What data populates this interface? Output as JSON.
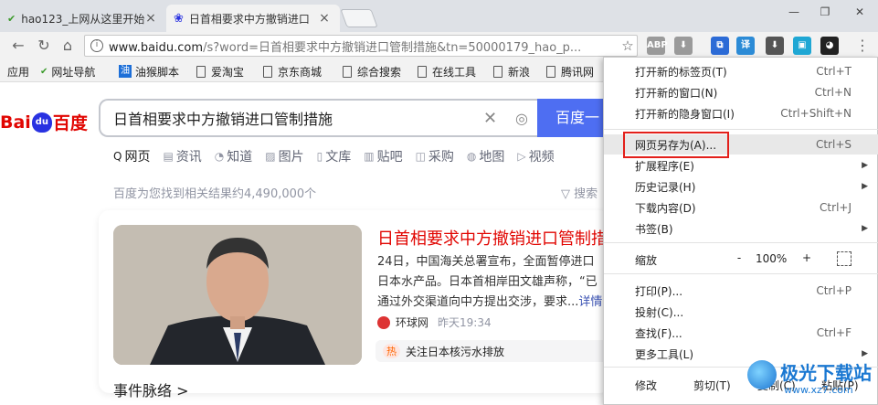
{
  "tabs": [
    {
      "title": "hao123_上网从这里开始",
      "icon": "hao123-icon",
      "active": false
    },
    {
      "title": "日首相要求中方撤销进口",
      "icon": "baidu-paw-icon",
      "active": true
    }
  ],
  "window_controls": {
    "minimize": "—",
    "restore": "❐",
    "close": "✕"
  },
  "toolbar": {
    "url_host": "www.baidu.com",
    "url_rest": "/s?word=日首相要求中方撤销进口管制措施&tn=50000179_hao_p...",
    "extensions": [
      {
        "name": "adblock-plus-icon",
        "label": "ABP",
        "color": "#9a9a9a"
      },
      {
        "name": "download-helper-icon",
        "label": "⬇",
        "color": "#9a9a9a"
      },
      {
        "name": "screenshot-ext-icon",
        "label": "⧉",
        "color": "#2c6bd6"
      },
      {
        "name": "translate-ext-icon",
        "label": "译",
        "color": "#2c8bd6"
      },
      {
        "name": "download-arrow-icon",
        "label": "⬇",
        "color": "#555555"
      },
      {
        "name": "capture-ext-icon",
        "label": "▣",
        "color": "#1fa7d4"
      },
      {
        "name": "mask-ext-icon",
        "label": "◕",
        "color": "#222222"
      }
    ]
  },
  "bookmarks": [
    {
      "label": "应用",
      "icon": "apps"
    },
    {
      "label": "网址导航",
      "icon": "hao"
    },
    {
      "label": "油猴脚本",
      "icon": "oil"
    },
    {
      "label": "爱淘宝",
      "icon": "doc"
    },
    {
      "label": "京东商城",
      "icon": "doc"
    },
    {
      "label": "综合搜索",
      "icon": "doc"
    },
    {
      "label": "在线工具",
      "icon": "doc"
    },
    {
      "label": "新浪",
      "icon": "doc"
    },
    {
      "label": "腾讯网",
      "icon": "doc"
    }
  ],
  "page": {
    "logo": {
      "left": "Bai",
      "paw": "du",
      "right": "百度"
    },
    "query": "日首相要求中方撤销进口管制措施",
    "search_button": "百度一",
    "nav_tabs": [
      {
        "icon": "Q",
        "label": "网页",
        "active": true
      },
      {
        "icon": "▤",
        "label": "资讯"
      },
      {
        "icon": "◔",
        "label": "知道"
      },
      {
        "icon": "▨",
        "label": "图片"
      },
      {
        "icon": "▯",
        "label": "文库"
      },
      {
        "icon": "▥",
        "label": "贴吧"
      },
      {
        "icon": "◫",
        "label": "采购"
      },
      {
        "icon": "◍",
        "label": "地图"
      },
      {
        "icon": "▷",
        "label": "视频"
      }
    ],
    "result_count": "百度为您找到相关结果约4,490,000个",
    "search_tools": "搜索",
    "news": {
      "title": "日首相要求中方撤销进口管制措",
      "body": "24日，中国海关总署宣布，全面暂停进口日本水产品。日本首相岸田文雄声称，“已通过外交渠道向中方提出交涉，要求...",
      "more": "详情 >",
      "source": "环球网",
      "time": "昨天19:34",
      "hot_badge": "热",
      "hot_text": "关注日本核污水排放"
    },
    "events": "事件脉络 >"
  },
  "menu": {
    "items": [
      {
        "label": "打开新的标签页(T)",
        "shortcut": "Ctrl+T"
      },
      {
        "label": "打开新的窗口(N)",
        "shortcut": "Ctrl+N"
      },
      {
        "label": "打开新的隐身窗口(I)",
        "shortcut": "Ctrl+Shift+N"
      },
      {
        "label": "网页另存为(A)...",
        "shortcut": "Ctrl+S"
      },
      {
        "label": "扩展程序(E)",
        "shortcut": ""
      },
      {
        "label": "历史记录(H)",
        "shortcut": ""
      },
      {
        "label": "下载内容(D)",
        "shortcut": "Ctrl+J"
      },
      {
        "label": "书签(B)",
        "shortcut": ""
      },
      {
        "label": "打印(P)...",
        "shortcut": "Ctrl+P"
      },
      {
        "label": "投射(C)...",
        "shortcut": ""
      },
      {
        "label": "查找(F)...",
        "shortcut": "Ctrl+F"
      },
      {
        "label": "更多工具(L)",
        "shortcut": ""
      }
    ],
    "zoom": {
      "label": "缩放",
      "minus": "-",
      "value": "100%",
      "plus": "+"
    },
    "edit": {
      "label": "修改",
      "cut": "剪切(T)",
      "copy": "复制(C)",
      "paste": "粘贴(P)"
    }
  },
  "watermark": {
    "text": "极光下载站",
    "url": "www.xz7.com"
  }
}
